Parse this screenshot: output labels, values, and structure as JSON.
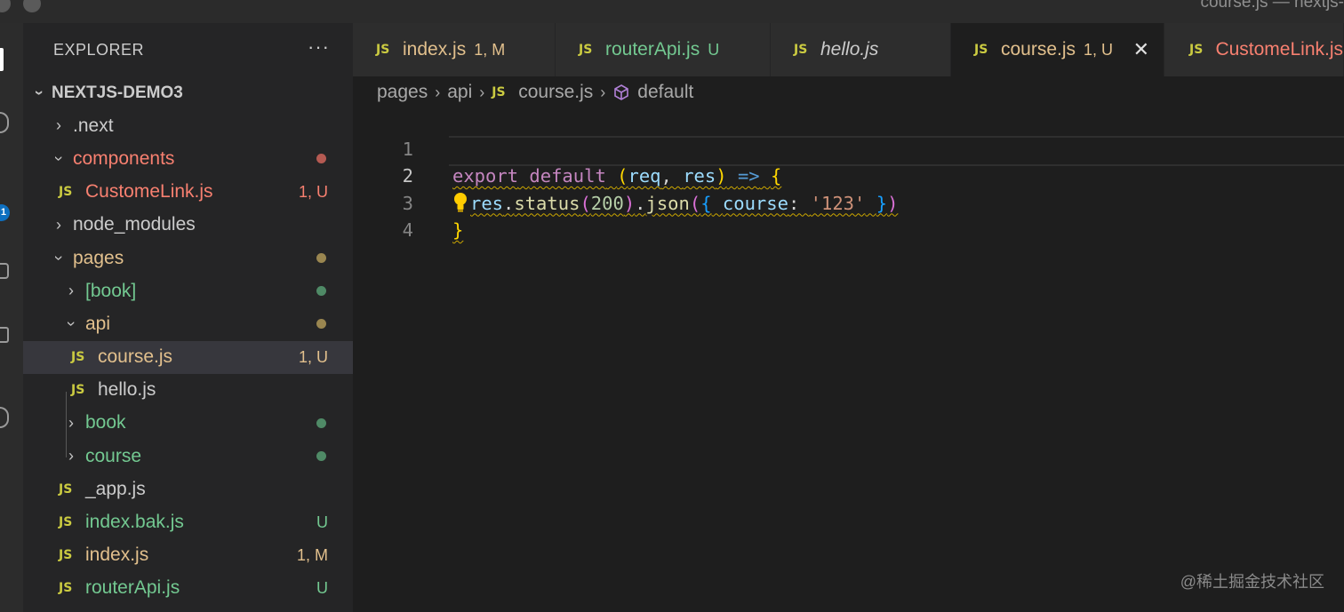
{
  "window": {
    "title": "course.js — nextjs-"
  },
  "activitybar": {
    "badge": "1"
  },
  "explorer": {
    "header": "EXPLORER",
    "more": "···",
    "project": "NEXTJS-DEMO3",
    "items": [
      {
        "label": ".next",
        "status": ""
      },
      {
        "label": "components",
        "status": ""
      },
      {
        "label": "CustomeLink.js",
        "status": "1, U"
      },
      {
        "label": "node_modules",
        "status": ""
      },
      {
        "label": "pages",
        "status": ""
      },
      {
        "label": "[book]",
        "status": ""
      },
      {
        "label": "api",
        "status": ""
      },
      {
        "label": "course.js",
        "status": "1, U"
      },
      {
        "label": "hello.js",
        "status": ""
      },
      {
        "label": "book",
        "status": ""
      },
      {
        "label": "course",
        "status": ""
      },
      {
        "label": "_app.js",
        "status": ""
      },
      {
        "label": "index.bak.js",
        "status": "U"
      },
      {
        "label": "index.js",
        "status": "1, M"
      },
      {
        "label": "routerApi.js",
        "status": "U"
      }
    ]
  },
  "tabs": [
    {
      "label": "index.js",
      "status": "1, M"
    },
    {
      "label": "routerApi.js",
      "status": "U"
    },
    {
      "label": "hello.js",
      "status": ""
    },
    {
      "label": "course.js",
      "status": "1, U"
    },
    {
      "label": "CustomeLink.js",
      "status": ""
    }
  ],
  "breadcrumbs": [
    "pages",
    "api",
    "course.js",
    "default"
  ],
  "code": {
    "line_numbers": [
      "1",
      "2",
      "3",
      "4"
    ],
    "l1": {
      "kw1": "export",
      "kw2": "default",
      "p1": "req",
      "p2": "res",
      "arrow": "=>"
    },
    "l2": {
      "obj": "res",
      "fn1": "status",
      "num": "200",
      "fn2": "json",
      "key": "course",
      "str": "'123'"
    }
  },
  "colors": {
    "modified": "#e2c08d",
    "untracked": "#73c991",
    "error": "#f88070",
    "js_icon": "#cbcb41"
  },
  "watermark": "@稀土掘金技术社区"
}
